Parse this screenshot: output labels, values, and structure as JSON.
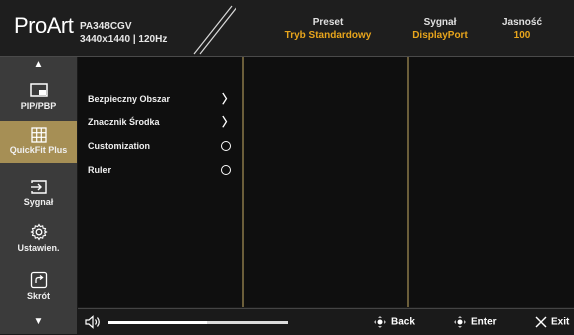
{
  "header": {
    "logo": "ProArt",
    "model_line1": "PA348CGV",
    "model_line2": "3440x1440 | 120Hz",
    "preset_label": "Preset",
    "preset_value": "Tryb Standardowy",
    "signal_label": "Sygnał",
    "signal_value": "DisplayPort",
    "brightness_label": "Jasność",
    "brightness_value": "100"
  },
  "sidebar": {
    "items": [
      {
        "label": "PIP/PBP",
        "icon": "pip-icon"
      },
      {
        "label": "QuickFit Plus",
        "icon": "grid-icon"
      },
      {
        "label": "Sygnał",
        "icon": "input-icon"
      },
      {
        "label": "Ustawien.",
        "icon": "gear-icon"
      },
      {
        "label": "Skrót",
        "icon": "shortcut-icon"
      }
    ],
    "active_index": 1
  },
  "menu": {
    "items": [
      {
        "label": "Bezpieczny Obszar",
        "control": "chevron"
      },
      {
        "label": "Znacznik Środka",
        "control": "chevron"
      },
      {
        "label": "Customization",
        "control": "radio"
      },
      {
        "label": "Ruler",
        "control": "radio"
      }
    ]
  },
  "footer": {
    "volume_level": 0.55,
    "back_label": "Back",
    "enter_label": "Enter",
    "exit_label": "Exit"
  },
  "colors": {
    "accent": "#e8a51c",
    "active_bg": "#a68f55",
    "sidebar_bg": "#3b3b3b"
  }
}
